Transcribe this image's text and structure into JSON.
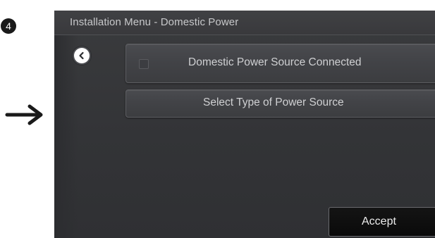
{
  "step_badge": "4",
  "screen": {
    "title": "Installation Menu - Domestic Power",
    "back_icon": "chevron-left-icon",
    "buttons": {
      "domestic_power": {
        "label": "Domestic Power Source Connected",
        "checked": false
      },
      "select_type": {
        "label": "Select Type of Power Source"
      },
      "accept": {
        "label": "Accept"
      }
    }
  },
  "pointer_icon": "arrow-right-icon",
  "colors": {
    "screen_background": "#333437",
    "button_text": "#cfd0d2",
    "accept_background": "#0f0f0f"
  }
}
